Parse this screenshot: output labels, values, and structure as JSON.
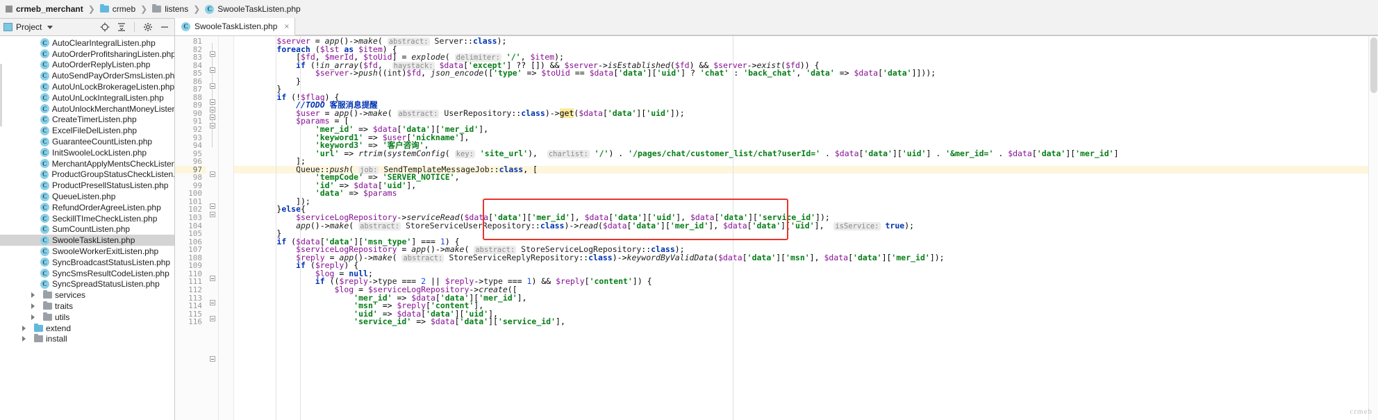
{
  "breadcrumb": {
    "items": [
      {
        "label": "crmeb_merchant",
        "icon": "module-icon",
        "bold": true
      },
      {
        "label": "crmeb",
        "icon": "folder-icon-blue",
        "bold": false
      },
      {
        "label": "listens",
        "icon": "folder-icon",
        "bold": false
      },
      {
        "label": "SwooleTaskListen.php",
        "icon": "php-class-icon",
        "bold": false
      }
    ],
    "separator": "〉"
  },
  "project_panel": {
    "title": "Project",
    "caret": "chevron-down-icon",
    "actions": [
      "locate-icon",
      "collapse-all-icon",
      "settings-icon",
      "hide-icon"
    ]
  },
  "tabs": [
    {
      "label": "SwooleTaskListen.php",
      "icon": "php-class-icon",
      "close": "×",
      "active": true
    }
  ],
  "tree": [
    {
      "label": "AutoClearIntegralListen.php",
      "type": "php",
      "depth": 4,
      "selected": false
    },
    {
      "label": "AutoOrderProfitsharingListen.php",
      "type": "php",
      "depth": 4,
      "selected": false
    },
    {
      "label": "AutoOrderReplyListen.php",
      "type": "php",
      "depth": 4,
      "selected": false
    },
    {
      "label": "AutoSendPayOrderSmsListen.php",
      "type": "php",
      "depth": 4,
      "selected": false
    },
    {
      "label": "AutoUnLockBrokerageListen.php",
      "type": "php",
      "depth": 4,
      "selected": false
    },
    {
      "label": "AutoUnLockIntegralListen.php",
      "type": "php",
      "depth": 4,
      "selected": false
    },
    {
      "label": "AutoUnlockMerchantMoneyListen",
      "type": "php",
      "depth": 4,
      "selected": false
    },
    {
      "label": "CreateTimerListen.php",
      "type": "php",
      "depth": 4,
      "selected": false
    },
    {
      "label": "ExcelFileDelListen.php",
      "type": "php",
      "depth": 4,
      "selected": false
    },
    {
      "label": "GuaranteeCountListen.php",
      "type": "php",
      "depth": 4,
      "selected": false
    },
    {
      "label": "InitSwooleLockListen.php",
      "type": "php",
      "depth": 4,
      "selected": false
    },
    {
      "label": "MerchantApplyMentsCheckListen.",
      "type": "php",
      "depth": 4,
      "selected": false
    },
    {
      "label": "ProductGroupStatusCheckListen.p",
      "type": "php",
      "depth": 4,
      "selected": false
    },
    {
      "label": "ProductPresellStatusListen.php",
      "type": "php",
      "depth": 4,
      "selected": false
    },
    {
      "label": "QueueListen.php",
      "type": "php",
      "depth": 4,
      "selected": false
    },
    {
      "label": "RefundOrderAgreeListen.php",
      "type": "php",
      "depth": 4,
      "selected": false
    },
    {
      "label": "SeckillTImeCheckListen.php",
      "type": "php",
      "depth": 4,
      "selected": false
    },
    {
      "label": "SumCountListen.php",
      "type": "php",
      "depth": 4,
      "selected": false
    },
    {
      "label": "SwooleTaskListen.php",
      "type": "php",
      "depth": 4,
      "selected": true
    },
    {
      "label": "SwooleWorkerExitListen.php",
      "type": "php",
      "depth": 4,
      "selected": false
    },
    {
      "label": "SyncBroadcastStatusListen.php",
      "type": "php",
      "depth": 4,
      "selected": false
    },
    {
      "label": "SyncSmsResultCodeListen.php",
      "type": "php",
      "depth": 4,
      "selected": false
    },
    {
      "label": "SyncSpreadStatusListen.php",
      "type": "php",
      "depth": 4,
      "selected": false
    },
    {
      "label": "services",
      "type": "folder",
      "depth": 3,
      "selected": false,
      "expandable": true
    },
    {
      "label": "traits",
      "type": "folder",
      "depth": 3,
      "selected": false,
      "expandable": true
    },
    {
      "label": "utils",
      "type": "folder",
      "depth": 3,
      "selected": false,
      "expandable": true
    },
    {
      "label": "extend",
      "type": "folder-blue",
      "depth": 2,
      "selected": false,
      "expandable": true
    },
    {
      "label": "install",
      "type": "folder",
      "depth": 2,
      "selected": false,
      "expandable": true
    }
  ],
  "editor": {
    "first_line": 81,
    "current_line": 97,
    "watermark": "crmeb",
    "lines": [
      {
        "n": 81,
        "text": "        $server = app()->make( abstract: Server::class);"
      },
      {
        "n": 82,
        "text": "        foreach ($lst as $item) {"
      },
      {
        "n": 83,
        "text": "            [$fd, $merId, $toUid] = explode( delimiter: '/', $item);"
      },
      {
        "n": 84,
        "text": "            if (!in_array($fd,  haystack: $data['except'] ?? []) && $server->isEstablished($fd) && $server->exist($fd)) {"
      },
      {
        "n": 85,
        "text": "                $server->push((int)$fd, json_encode(['type' => $toUid == $data['data']['uid'] ? 'chat' : 'back_chat', 'data' => $data['data']]));"
      },
      {
        "n": 86,
        "text": "            }"
      },
      {
        "n": 87,
        "text": "        }"
      },
      {
        "n": 88,
        "text": "        if (!$flag) {"
      },
      {
        "n": 89,
        "text": "            //TODO 客服消息提醒"
      },
      {
        "n": 90,
        "text": "            $user = app()->make( abstract: UserRepository::class)->get($data['data']['uid']);"
      },
      {
        "n": 91,
        "text": "            $params = ["
      },
      {
        "n": 92,
        "text": "                'mer_id' => $data['data']['mer_id'],"
      },
      {
        "n": 93,
        "text": "                'keyword1' => $user['nickname'],"
      },
      {
        "n": 94,
        "text": "                'keyword3' => '客户咨询',"
      },
      {
        "n": 95,
        "text": "                'url' => rtrim(systemConfig( key: 'site_url'),  charlist: '/') . '/pages/chat/customer_list/chat?userId=' . $data['data']['uid'] . '&mer_id=' . $data['data']['mer_id']"
      },
      {
        "n": 96,
        "text": "            ];"
      },
      {
        "n": 97,
        "text": "            Queue::push( job: SendTemplateMessageJob::class, ["
      },
      {
        "n": 98,
        "text": "                'tempCode' => 'SERVER_NOTICE',"
      },
      {
        "n": 99,
        "text": "                'id' => $data['uid'],"
      },
      {
        "n": 100,
        "text": "                'data' => $params"
      },
      {
        "n": 101,
        "text": "            ]);"
      },
      {
        "n": 102,
        "text": "        }else{"
      },
      {
        "n": 103,
        "text": "            $serviceLogRepository->serviceRead($data['data']['mer_id'], $data['data']['uid'], $data['data']['service_id']);"
      },
      {
        "n": 104,
        "text": "            app()->make( abstract: StoreServiceUserRepository::class)->read($data['data']['mer_id'], $data['data']['uid'],  isService: true);"
      },
      {
        "n": 105,
        "text": "        }"
      },
      {
        "n": 106,
        "text": "        if ($data['data']['msn_type'] === 1) {"
      },
      {
        "n": 107,
        "text": "            $serviceLogRepository = app()->make( abstract: StoreServiceLogRepository::class);"
      },
      {
        "n": 108,
        "text": "            $reply = app()->make( abstract: StoreServiceReplyRepository::class)->keywordByValidData($data['data']['msn'], $data['data']['mer_id']);"
      },
      {
        "n": 109,
        "text": "            if ($reply) {"
      },
      {
        "n": 110,
        "text": "                $log = null;"
      },
      {
        "n": 111,
        "text": "                if (($reply->type === 2 || $reply->type === 1) && $reply['content']) {"
      },
      {
        "n": 112,
        "text": "                    $log = $serviceLogRepository->create(["
      },
      {
        "n": 113,
        "text": "                        'mer_id' => $data['data']['mer_id'],"
      },
      {
        "n": 114,
        "text": "                        'msn' => $reply['content'],"
      },
      {
        "n": 115,
        "text": "                        'uid' => $data['data']['uid'],"
      },
      {
        "n": 116,
        "text": "                        'service_id' => $data['data']['service_id'],"
      }
    ],
    "annotation": {
      "type": "red-rectangle",
      "color": "#e8342a",
      "covers_lines": [
        97,
        98,
        99,
        100,
        101
      ]
    }
  }
}
